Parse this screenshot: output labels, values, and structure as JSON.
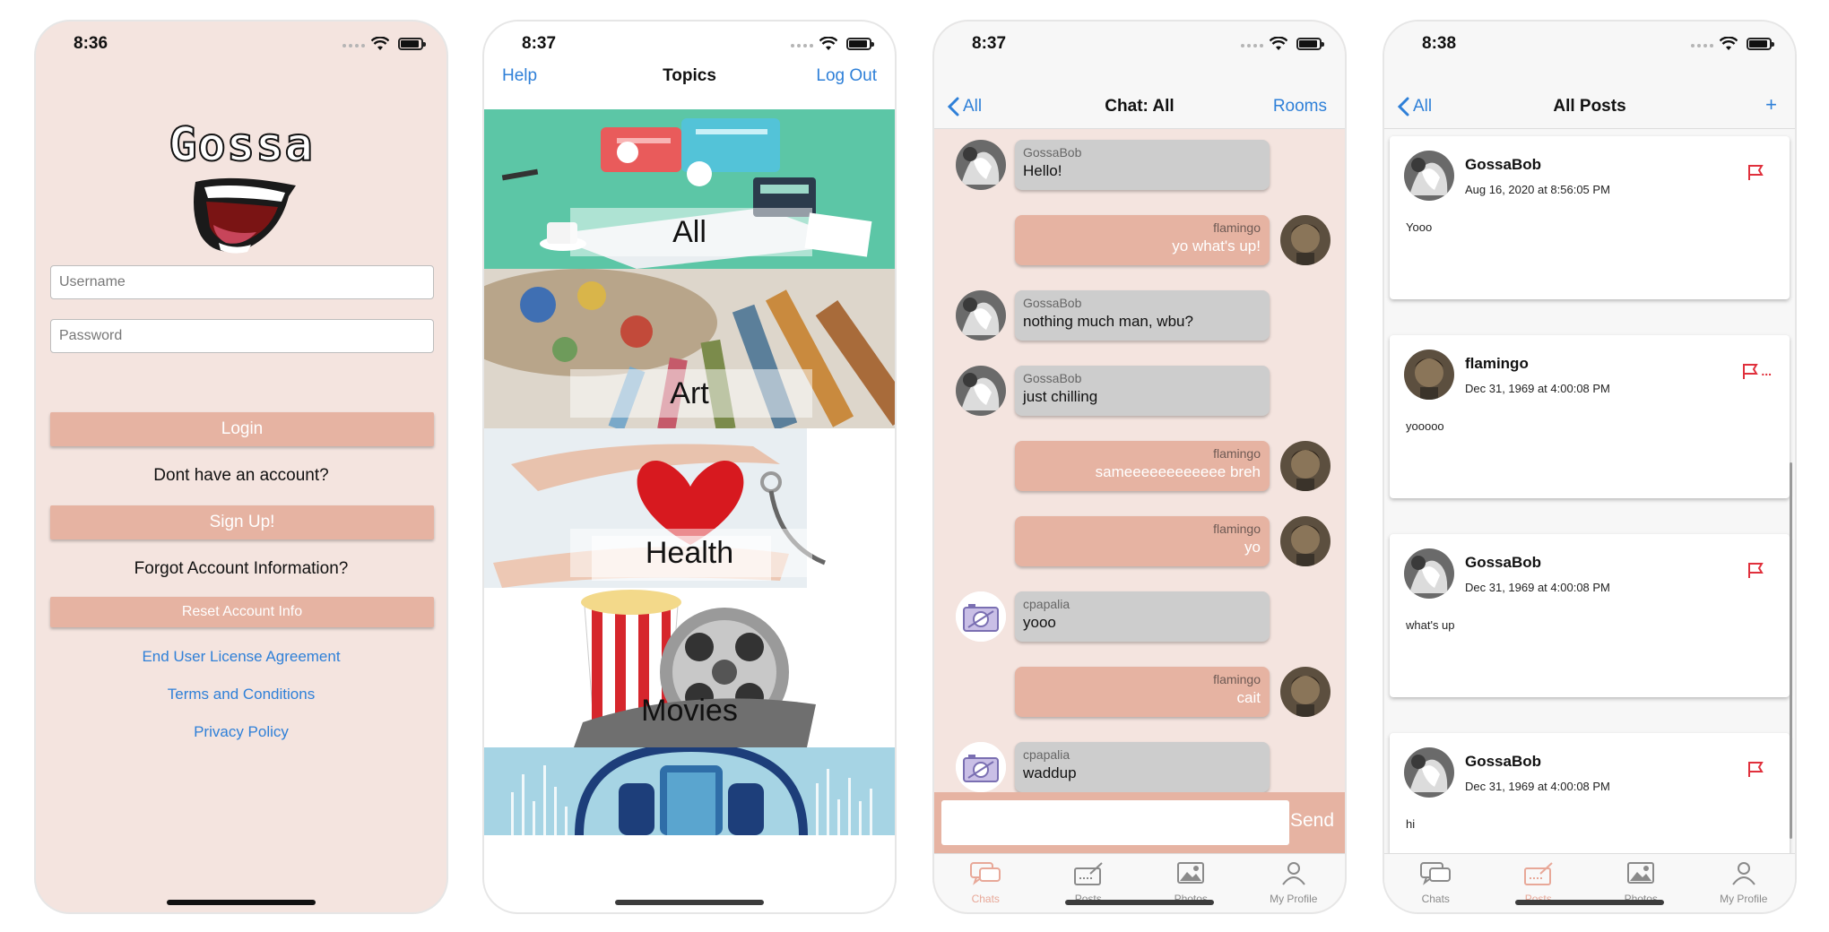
{
  "phones": {
    "login": {
      "time": "8:36",
      "logo_text": "Gossa",
      "username_placeholder": "Username",
      "password_placeholder": "Password",
      "login_label": "Login",
      "no_account_text": "Dont have an account?",
      "signup_label": "Sign Up!",
      "forgot_text": "Forgot Account Information?",
      "reset_label": "Reset Account Info",
      "links": [
        "End User License Agreement",
        "Terms and Conditions",
        "Privacy Policy"
      ]
    },
    "topics": {
      "time": "8:37",
      "help_label": "Help",
      "title": "Topics",
      "logout_label": "Log Out",
      "items": [
        {
          "label": "All"
        },
        {
          "label": "Art"
        },
        {
          "label": "Health"
        },
        {
          "label": "Movies"
        },
        {
          "label": ""
        }
      ]
    },
    "chat": {
      "time": "8:37",
      "back_label": "All",
      "title": "Chat: All",
      "rooms_label": "Rooms",
      "messages": [
        {
          "user": "GossaBob",
          "text": "Hello!",
          "dir": "in"
        },
        {
          "user": "flamingo",
          "text": "yo what's up!",
          "dir": "out"
        },
        {
          "user": "GossaBob",
          "text": "nothing much man, wbu?",
          "dir": "in"
        },
        {
          "user": "GossaBob",
          "text": "just chilling",
          "dir": "in"
        },
        {
          "user": "flamingo",
          "text": "sameeeeeeeeeeee breh",
          "dir": "out"
        },
        {
          "user": "flamingo",
          "text": "yo",
          "dir": "out"
        },
        {
          "user": "cpapalia",
          "text": "yooo",
          "dir": "in"
        },
        {
          "user": "flamingo",
          "text": "cait",
          "dir": "out"
        },
        {
          "user": "cpapalia",
          "text": "waddup",
          "dir": "in"
        }
      ],
      "send_label": "Send",
      "tabs": [
        "Chats",
        "Posts",
        "Photos",
        "My Profile"
      ]
    },
    "posts": {
      "time": "8:38",
      "back_label": "All",
      "title": "All Posts",
      "add_label": "+",
      "items": [
        {
          "user": "GossaBob",
          "date": "Aug 16, 2020 at 8:56:05 PM",
          "text": "Yooo"
        },
        {
          "user": "flamingo",
          "date": "Dec 31, 1969 at 4:00:08 PM",
          "text": "yooooo",
          "flag_suffix": "..."
        },
        {
          "user": "GossaBob",
          "date": "Dec 31, 1969 at 4:00:08 PM",
          "text": "what's up"
        },
        {
          "user": "GossaBob",
          "date": "Dec 31, 1969 at 4:00:08 PM",
          "text": "hi"
        }
      ],
      "tabs": [
        "Chats",
        "Posts",
        "Photos",
        "My Profile"
      ]
    }
  },
  "colors": {
    "login_bg": "#f4e4df",
    "accent_pink": "#e6b3a2",
    "link_blue": "#2f80d8",
    "incoming_bubble": "#cdcdcd",
    "flag_red": "#e0303c"
  }
}
